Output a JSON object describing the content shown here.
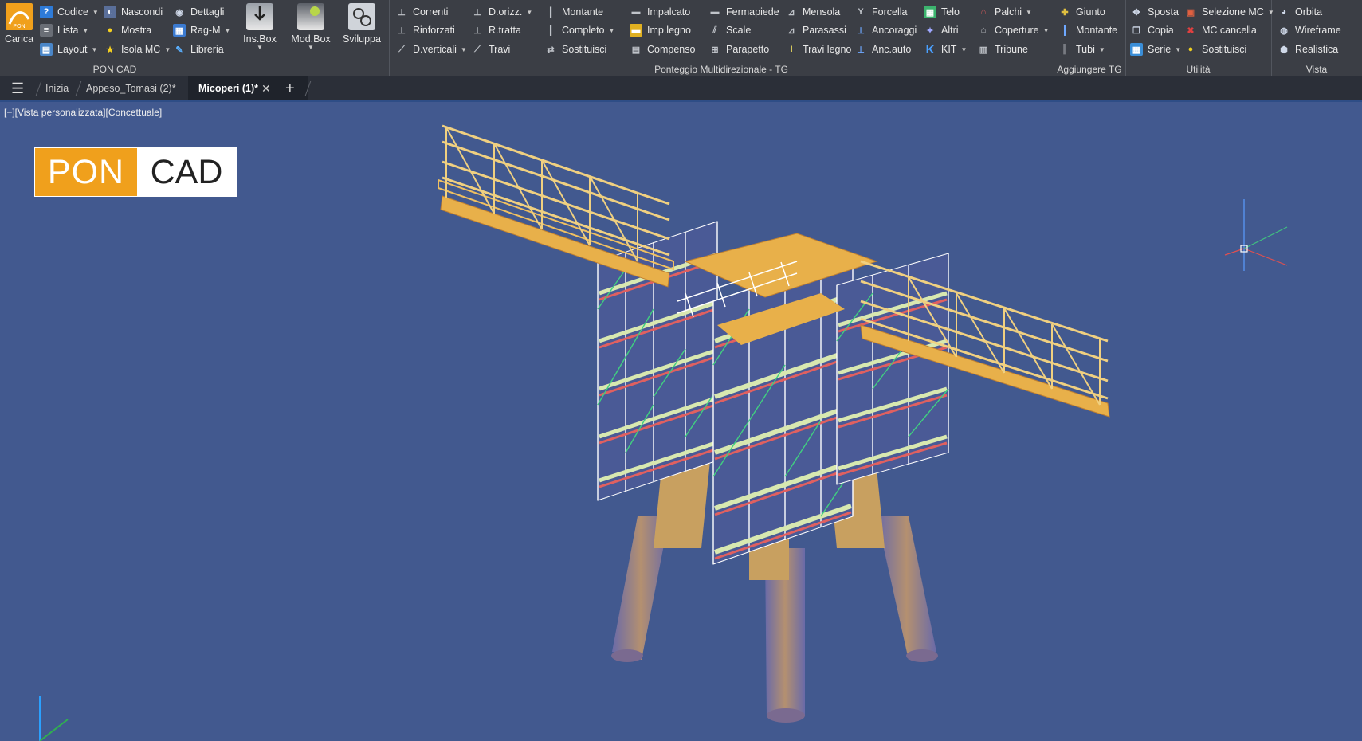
{
  "ribbon": {
    "poncad": {
      "title": "PON CAD",
      "carica": "Carica",
      "codice": "Codice",
      "lista": "Lista",
      "layout": "Layout",
      "nascondi": "Nascondi",
      "mostra": "Mostra",
      "isola_mc": "Isola MC",
      "dettagli": "Dettagli",
      "rag_m": "Rag-M",
      "libreria": "Libreria"
    },
    "box": {
      "ins_box": "Ins.Box",
      "mod_box": "Mod.Box",
      "sviluppa": "Sviluppa"
    },
    "ponteggio": {
      "title": "Ponteggio Multidirezionale - TG",
      "correnti": "Correnti",
      "rinforzati": "Rinforzati",
      "d_verticali": "D.verticali",
      "d_orizz": "D.orizz.",
      "r_tratta": "R.tratta",
      "travi": "Travi",
      "montante": "Montante",
      "completo": "Completo",
      "sostituisci": "Sostituisci",
      "impalcato": "Impalcato",
      "imp_legno": "Imp.legno",
      "compenso": "Compenso",
      "fermapiede": "Fermapiede",
      "scale": "Scale",
      "parapetto": "Parapetto",
      "mensola": "Mensola",
      "parasassi": "Parasassi",
      "travi_legno": "Travi legno",
      "forcella": "Forcella",
      "ancoraggi": "Ancoraggi",
      "anc_auto": "Anc.auto",
      "telo": "Telo",
      "altri": "Altri",
      "kit": "KIT",
      "palchi": "Palchi",
      "coperture": "Coperture",
      "tribune": "Tribune"
    },
    "aggiungere": {
      "title": "Aggiungere TG",
      "giunto": "Giunto",
      "montante": "Montante",
      "tubi": "Tubi"
    },
    "utilita": {
      "title": "Utilità",
      "sposta": "Sposta",
      "copia": "Copia",
      "serie": "Serie",
      "selezione_mc": "Selezione MC",
      "mc_cancella": "MC cancella",
      "sostituisci": "Sostituisci"
    },
    "vista": {
      "title": "Vista",
      "orbita": "Orbita",
      "wireframe": "Wireframe",
      "realistica": "Realistica"
    }
  },
  "tabs": {
    "inizia": "Inizia",
    "appeso": "Appeso_Tomasi (2)*",
    "micoperi": "Micoperi (1)*"
  },
  "viewport": {
    "label": "[−][Vista personalizzata][Concettuale]",
    "logo_left": "PON",
    "logo_right": "CAD"
  },
  "colors": {
    "background": "#42598f",
    "ribbon": "#3b3e45",
    "tabbar": "#2b2f38",
    "brand_orange": "#f0a01c",
    "deck": "#e8b04a"
  }
}
